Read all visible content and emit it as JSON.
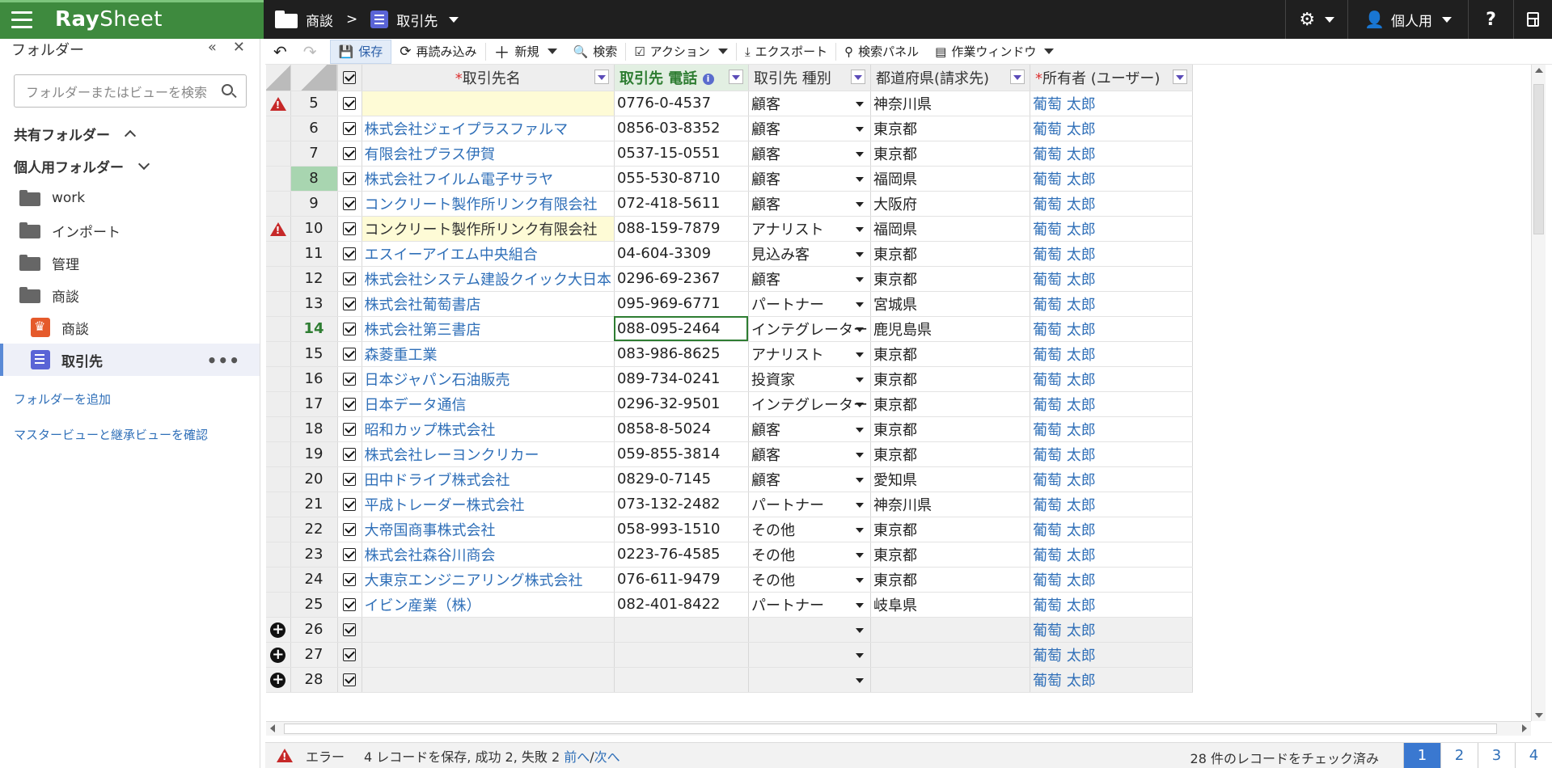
{
  "app": {
    "logo_a": "Ray",
    "logo_b": "Sheet"
  },
  "breadcrumb": {
    "folder": "商談",
    "sep": ">",
    "view": "取引先"
  },
  "topright": {
    "personal": "個人用",
    "help": "?"
  },
  "sidebar": {
    "title": "フォルダー",
    "collapse": "«",
    "close": "✕",
    "search_placeholder": "フォルダーまたはビューを検索",
    "shared": "共有フォルダー",
    "personal": "個人用フォルダー",
    "folders": [
      "work",
      "インポート",
      "管理",
      "商談"
    ],
    "sub_items": [
      "商談",
      "取引先"
    ],
    "more": "•••",
    "add_folder": "フォルダーを追加",
    "confirm_link": "マスタービューと継承ビューを確認"
  },
  "toolbar": {
    "undo": "↶",
    "redo": "↷",
    "save": "保存",
    "reload": "再読み込み",
    "new": "新規",
    "search": "検索",
    "action": "アクション",
    "export": "エクスポート",
    "search_panel": "検索パネル",
    "work_window": "作業ウィンドウ"
  },
  "grid": {
    "headers": {
      "name": "取引先名",
      "tel": "取引先 電話",
      "type": "取引先 種別",
      "pref": "都道府県(請求先)",
      "owner": "所有者 (ユーザー)"
    },
    "required_mark": "*",
    "info_mark": "i",
    "rows": [
      {
        "n": "5",
        "name": "",
        "tel": "0776-0-4537",
        "type": "顧客",
        "pref": "神奈川県",
        "owner": "葡萄 太郎",
        "mark": "warn"
      },
      {
        "n": "6",
        "name": "株式会社ジェイプラスファルマ",
        "tel": "0856-03-8352",
        "type": "顧客",
        "pref": "東京都",
        "owner": "葡萄 太郎"
      },
      {
        "n": "7",
        "name": "有限会社プラス伊賀",
        "tel": "0537-15-0551",
        "type": "顧客",
        "pref": "東京都",
        "owner": "葡萄 太郎"
      },
      {
        "n": "8",
        "name": "株式会社フイルム電子サラヤ",
        "tel": "055-530-8710",
        "type": "顧客",
        "pref": "福岡県",
        "owner": "葡萄 太郎"
      },
      {
        "n": "9",
        "name": "コンクリート製作所リンク有限会社",
        "tel": "072-418-5611",
        "type": "顧客",
        "pref": "大阪府",
        "owner": "葡萄 太郎"
      },
      {
        "n": "10",
        "name": "コンクリート製作所リンク有限会社",
        "tel": "088-159-7879",
        "type": "アナリスト",
        "pref": "福岡県",
        "owner": "葡萄 太郎",
        "mark": "warn"
      },
      {
        "n": "11",
        "name": "エスイーアイエム中央組合",
        "tel": "04-604-3309",
        "type": "見込み客",
        "pref": "東京都",
        "owner": "葡萄 太郎"
      },
      {
        "n": "12",
        "name": "株式会社システム建設クイック大日本",
        "tel": "0296-69-2367",
        "type": "顧客",
        "pref": "東京都",
        "owner": "葡萄 太郎"
      },
      {
        "n": "13",
        "name": "株式会社葡萄書店",
        "tel": "095-969-6771",
        "type": "パートナー",
        "pref": "宮城県",
        "owner": "葡萄 太郎"
      },
      {
        "n": "14",
        "name": "株式会社第三書店",
        "tel": "088-095-2464",
        "type": "インテグレーター",
        "pref": "鹿児島県",
        "owner": "葡萄 太郎"
      },
      {
        "n": "15",
        "name": "森菱重工業",
        "tel": "083-986-8625",
        "type": "アナリスト",
        "pref": "東京都",
        "owner": "葡萄 太郎"
      },
      {
        "n": "16",
        "name": "日本ジャパン石油販売",
        "tel": "089-734-0241",
        "type": "投資家",
        "pref": "東京都",
        "owner": "葡萄 太郎"
      },
      {
        "n": "17",
        "name": "日本データ通信",
        "tel": "0296-32-9501",
        "type": "インテグレーター",
        "pref": "東京都",
        "owner": "葡萄 太郎"
      },
      {
        "n": "18",
        "name": "昭和カップ株式会社",
        "tel": "0858-8-5024",
        "type": "顧客",
        "pref": "東京都",
        "owner": "葡萄 太郎"
      },
      {
        "n": "19",
        "name": "株式会社レーヨンクリカー",
        "tel": "059-855-3814",
        "type": "顧客",
        "pref": "東京都",
        "owner": "葡萄 太郎"
      },
      {
        "n": "20",
        "name": "田中ドライブ株式会社",
        "tel": "0829-0-7145",
        "type": "顧客",
        "pref": "愛知県",
        "owner": "葡萄 太郎"
      },
      {
        "n": "21",
        "name": "平成トレーダー株式会社",
        "tel": "073-132-2482",
        "type": "パートナー",
        "pref": "神奈川県",
        "owner": "葡萄 太郎"
      },
      {
        "n": "22",
        "name": "大帝国商事株式会社",
        "tel": "058-993-1510",
        "type": "その他",
        "pref": "東京都",
        "owner": "葡萄 太郎"
      },
      {
        "n": "23",
        "name": "株式会社森谷川商会",
        "tel": "0223-76-4585",
        "type": "その他",
        "pref": "東京都",
        "owner": "葡萄 太郎"
      },
      {
        "n": "24",
        "name": "大東京エンジニアリング株式会社",
        "tel": "076-611-9479",
        "type": "その他",
        "pref": "東京都",
        "owner": "葡萄 太郎"
      },
      {
        "n": "25",
        "name": "イビン産業（株）",
        "tel": "082-401-8422",
        "type": "パートナー",
        "pref": "岐阜県",
        "owner": "葡萄 太郎"
      },
      {
        "n": "26",
        "name": "",
        "tel": "",
        "type": "",
        "pref": "",
        "owner": "葡萄 太郎",
        "mark": "plus"
      },
      {
        "n": "27",
        "name": "",
        "tel": "",
        "type": "",
        "pref": "",
        "owner": "葡萄 太郎",
        "mark": "plus"
      },
      {
        "n": "28",
        "name": "",
        "tel": "",
        "type": "",
        "pref": "",
        "owner": "葡萄 太郎",
        "mark": "plus"
      }
    ]
  },
  "status": {
    "error_label": "エラー",
    "message": "4 レコードを保存, 成功 2, 失敗 2",
    "prev": "前へ",
    "slash": "/",
    "next": "次へ",
    "checked": "28 件のレコードをチェック済み",
    "pages": [
      "1",
      "2",
      "3",
      "4"
    ]
  }
}
